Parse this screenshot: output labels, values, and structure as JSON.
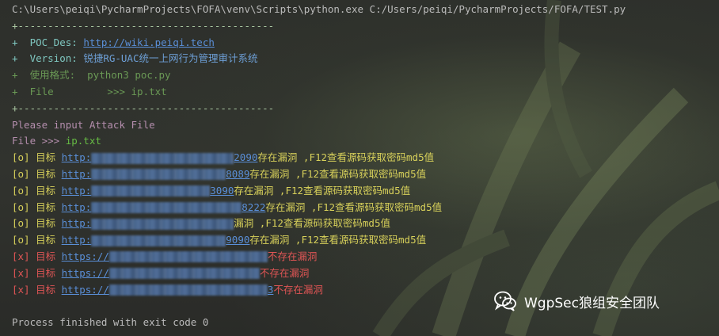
{
  "command": "C:\\Users\\peiqi\\PycharmProjects\\FOFA\\venv\\Scripts\\python.exe C:/Users/peiqi/PycharmProjects/FOFA/TEST.py",
  "banner": {
    "rule": "+-------------------------------------------",
    "poc_des_label": "+  POC_Des: ",
    "poc_des_url": "http://wiki.peiqi.tech",
    "version_label": "+  Version: ",
    "version_value": "锐捷RG-UAC统一上网行为管理审计系统",
    "usage_label": "+  使用格式:  ",
    "usage_value": "python3 poc.py",
    "file_label": "+  File         ",
    "file_value": ">>> ip.txt",
    "rule_end": "+-------------------------------------------"
  },
  "prompt": {
    "ask": "Please input Attack File",
    "file_prompt": "File >>> ",
    "file_input": "ip.txt"
  },
  "results": [
    {
      "status": "[o] 目标 ",
      "url_prefix": "http:",
      "url_tail": "2090",
      "msg": "存在漏洞 ,F12查看源码获取密码md5值"
    },
    {
      "status": "[o] 目标 ",
      "url_prefix": "http:",
      "url_tail": "8089",
      "msg": "存在漏洞 ,F12查看源码获取密码md5值"
    },
    {
      "status": "[o] 目标 ",
      "url_prefix": "http:",
      "url_tail": "3090",
      "msg": "存在漏洞 ,F12查看源码获取密码md5值"
    },
    {
      "status": "[o] 目标 ",
      "url_prefix": "http:",
      "url_tail": "8222",
      "msg": "存在漏洞 ,F12查看源码获取密码md5值"
    },
    {
      "status": "[o] 目标 ",
      "url_prefix": "http:",
      "url_tail": "",
      "msg": "漏洞 ,F12查看源码获取密码md5值"
    },
    {
      "status": "[o] 目标 ",
      "url_prefix": "http:",
      "url_tail": "9090",
      "msg": "存在漏洞 ,F12查看源码获取密码md5值"
    },
    {
      "status": "[x] 目标 ",
      "url_prefix": "https://",
      "url_tail": "",
      "msg": "不存在漏洞"
    },
    {
      "status": "[x] 目标 ",
      "url_prefix": "https://",
      "url_tail": "",
      "msg": "不存在漏洞"
    },
    {
      "status": "[x] 目标 ",
      "url_prefix": "https://",
      "url_tail": "3",
      "msg": "不存在漏洞"
    }
  ],
  "exit": "Process finished with exit code 0",
  "watermark": {
    "text": "WgpSec狼组安全团队",
    "icon": "wechat-icon"
  },
  "colors": {
    "background": "#2b2b2b",
    "link": "#5a8fd8",
    "success": "#d7d05a",
    "fail": "#e05555"
  }
}
